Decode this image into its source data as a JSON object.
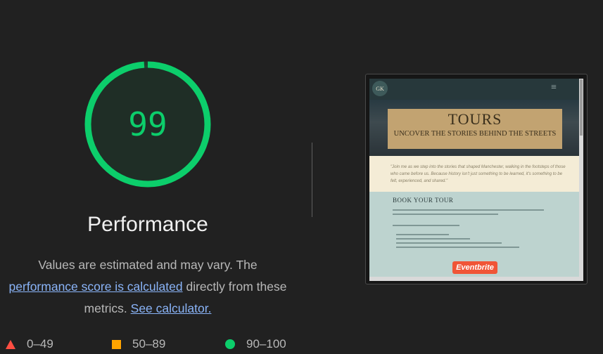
{
  "gauge": {
    "score": "99",
    "score_fraction": 0.99,
    "title": "Performance",
    "color": "#0cce6b"
  },
  "description": {
    "prefix": "Values are estimated and may vary. The",
    "link1": "performance score is calculated",
    "middle": "directly from these",
    "metrics": "metrics.",
    "link2": "See calculator."
  },
  "legend": [
    {
      "label": "0–49",
      "shape": "triangle",
      "color": "#ff4e42"
    },
    {
      "label": "50–89",
      "shape": "square",
      "color": "#ffa400"
    },
    {
      "label": "90–100",
      "shape": "circle",
      "color": "#0cce6b"
    }
  ],
  "screenshot": {
    "logo": "GK",
    "menu_icon": "hamburger-icon",
    "hero_title": "TOURS",
    "hero_subtitle": "UNCOVER THE STORIES BEHIND THE STREETS",
    "quote": "\"Join me as we step into the stories that shaped Manchester, walking in the footsteps of those who came before us. Because history isn't just something to be learned, it's something to be felt, experienced, and shared.\"",
    "book_title": "BOOK YOUR TOUR",
    "button": "Eventbrite"
  }
}
